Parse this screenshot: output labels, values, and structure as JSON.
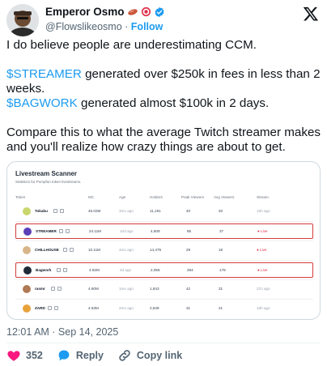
{
  "author": {
    "display_name": "Emperor Osmo",
    "handle": "@Flowslikeosmo",
    "follow_separator": "·",
    "follow_label": "Follow"
  },
  "tweet": {
    "line1": "I do believe people are underestimating CCM.",
    "cashtag1": "$STREAMER",
    "line2_rest": " generated over $250k in fees in less than 2 weeks.",
    "cashtag2": "$BAGWORK",
    "line3_rest": " generated almost $100k in 2 days.",
    "line4": "Compare this to what the average Twitch streamer makes and you'll realize how crazy things are about to get."
  },
  "card": {
    "title": "Livestream Scanner",
    "subtitle": "Statistics for Pumpfun token livestreams.",
    "columns": [
      "Token",
      "MC",
      "Age",
      "Holders",
      "Peak Viewers",
      "Avg Viewers",
      "Stream"
    ],
    "rows": [
      {
        "name": "Tokabu",
        "mc": "45.02M",
        "age": "3mo ago",
        "holders": "11,191",
        "peak": "40",
        "avg": "20",
        "stream": "15h ago",
        "highlight": false,
        "icon_color": "#c9d66b"
      },
      {
        "name": "STREAMER",
        "mc": "24.11M",
        "age": "10d ago",
        "holders": "4,609",
        "peak": "85",
        "avg": "37",
        "stream": "● Live",
        "highlight": true,
        "icon_color": "#5b3fb8"
      },
      {
        "name": "CHILLHOUSE",
        "mc": "10.11M",
        "age": "4mo ago",
        "holders": "14,475",
        "peak": "29",
        "avg": "18",
        "stream": "● Live",
        "highlight": false,
        "icon_color": "#d9b58a"
      },
      {
        "name": "Bagwork",
        "mc": "4.62M",
        "age": "2d ago",
        "holders": "2,056",
        "peak": "494",
        "avg": "178",
        "stream": "● Live",
        "highlight": true,
        "icon_color": "#1f2937"
      },
      {
        "name": "rasmr",
        "mc": "4.60M",
        "age": "1mo ago",
        "holders": "1,843",
        "peak": "42",
        "avg": "31",
        "stream": "21h ago",
        "highlight": false,
        "icon_color": "#b07a54"
      },
      {
        "name": "ZARD",
        "mc": "4.53M",
        "age": "2mo ago",
        "holders": "2,849",
        "peak": "31",
        "avg": "21",
        "stream": "18h ago",
        "highlight": false,
        "icon_color": "#e7a23a"
      }
    ]
  },
  "meta": {
    "timestamp": "12:01 AM · Sep 14, 2025"
  },
  "actions": {
    "likes": "352",
    "reply": "Reply",
    "copy_link": "Copy link"
  },
  "colors": {
    "accent": "#1d9bf0",
    "like": "#f91880",
    "highlight_border": "#d43a3a"
  }
}
